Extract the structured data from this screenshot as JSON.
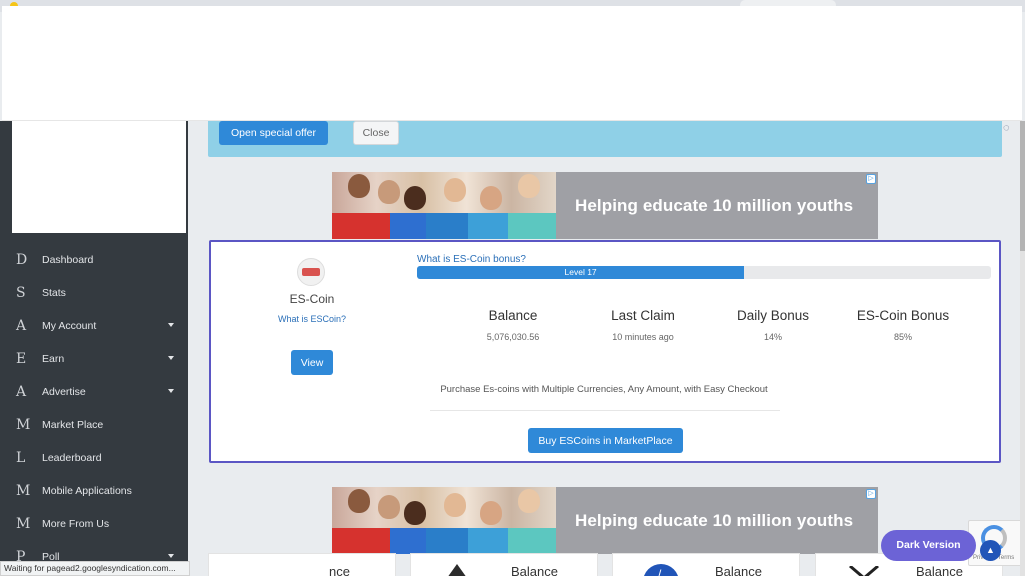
{
  "offer": {
    "open_label": "Open special offer",
    "close_label": "Close"
  },
  "ads": [
    {
      "text": "Helping educate 10 million youths"
    },
    {
      "text": "Helping educate 10 million youths"
    }
  ],
  "sidebar": {
    "items": [
      {
        "letter": "D",
        "label": "Dashboard",
        "has_caret": false
      },
      {
        "letter": "S",
        "label": "Stats",
        "has_caret": false
      },
      {
        "letter": "A",
        "label": "My Account",
        "has_caret": true
      },
      {
        "letter": "E",
        "label": "Earn",
        "has_caret": true
      },
      {
        "letter": "A",
        "label": "Advertise",
        "has_caret": true
      },
      {
        "letter": "M",
        "label": "Market Place",
        "has_caret": false
      },
      {
        "letter": "L",
        "label": "Leaderboard",
        "has_caret": false
      },
      {
        "letter": "M",
        "label": "Mobile Applications",
        "has_caret": false
      },
      {
        "letter": "M",
        "label": "More From Us",
        "has_caret": false
      },
      {
        "letter": "P",
        "label": "Poll",
        "has_caret": true
      }
    ]
  },
  "coin": {
    "name": "ES-Coin",
    "what_link": "What is ESCoin?",
    "view_label": "View",
    "bonus_link": "What is ES-Coin bonus?",
    "level_label": "Level 17",
    "level_progress": 0.57,
    "stats": [
      {
        "title": "Balance",
        "value": "5,076,030.56"
      },
      {
        "title": "Last Claim",
        "value": "10 minutes ago"
      },
      {
        "title": "Daily Bonus",
        "value": "14%"
      },
      {
        "title": "ES-Coin Bonus",
        "value": "85%"
      }
    ],
    "purchase_text": "Purchase Es-coins with Multiple Currencies, Any Amount, with Easy Checkout",
    "buy_label": "Buy ESCoins in MarketPlace"
  },
  "balance_cards": [
    {
      "label": "nce"
    },
    {
      "label": "Balance",
      "icon": "triangle-coin-icon"
    },
    {
      "label": "Balance",
      "icon": "litecoin-icon"
    },
    {
      "label": "Balance",
      "icon": "x-coin-icon"
    }
  ],
  "dark_version_label": "Dark Version",
  "recaptcha_terms": "Privacy - Terms",
  "status_text": "Waiting for pagead2.googlesyndication.com..."
}
